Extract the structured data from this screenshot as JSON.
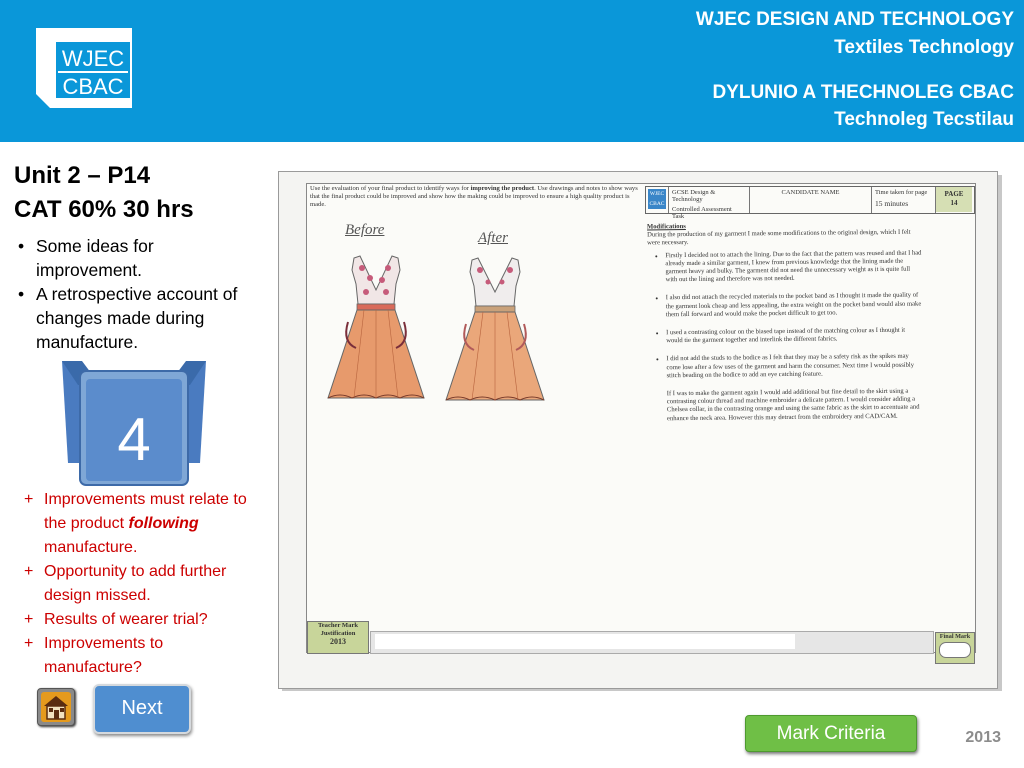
{
  "header": {
    "line1": "WJEC DESIGN AND TECHNOLOGY",
    "line2": "Textiles Technology",
    "line3": "DYLUNIO A THECHNOLEG CBAC",
    "line4": "Technoleg Tecstilau",
    "logo_top": "WJEC",
    "logo_bottom": "CBAC",
    "bg_color": "#0a97d9"
  },
  "unit": {
    "title": "Unit 2 – P14",
    "subtitle": "CAT 60% 30 hrs"
  },
  "bullets": [
    "Some ideas for improvement.",
    "A retrospective account of changes made during manufacture."
  ],
  "section_number": "4",
  "improvements": [
    {
      "before": "Improvements must relate to the product ",
      "emph": "following",
      "after": " manufacture."
    },
    {
      "before": "Opportunity to add further design missed.",
      "emph": "",
      "after": ""
    },
    {
      "before": "Results of wearer trial?",
      "emph": "",
      "after": ""
    },
    {
      "before": "Improvements to manufacture?",
      "emph": "",
      "after": ""
    }
  ],
  "buttons": {
    "home_icon": "home-icon",
    "next": "Next",
    "mark_criteria": "Mark Criteria"
  },
  "year": "2013",
  "document": {
    "instructions_pre": "Use the evaluation of your final product to identify ways for ",
    "instructions_bold": "improving the product",
    "instructions_post": ". Use drawings and notes to show ways that the final product could be improved and show how the making could be improved to ensure a high quality product is made.",
    "header_logo_top": "WJEC",
    "header_logo_bottom": "CBAC",
    "course": "GCSE Design & Technology",
    "task": "Controlled Assessment Task",
    "candidate_label": "CANDIDATE NAME",
    "time_label": "Time taken for page",
    "time_value": "15",
    "time_unit": "minutes",
    "page_label": "PAGE",
    "page_number": "14",
    "label_before": "Before",
    "label_after": "After",
    "mods_title": "Modifications",
    "mods_intro": "During the production of my garment I made some modifications to the original design, which I felt were necessary.",
    "mods_points": [
      "Firstly I decided not to attach the lining. Due to the fact that the pattern was reused and that I had already made a similar garment, I knew from previous knowledge that the lining made the garment heavy and bulky. The garment did not need the unnecessary weight as it is quite full with out the lining and therefore was not needed.",
      "I also did not attach the recycled materials to the pocket band as I thought it made the quality of the garment look cheap and less appealing, the extra weight on the pocket band would also make them fall forward and would make the pocket difficult to get too.",
      "I used a contrasting colour on the biased tape instead of the matching colour as I thought it would tie the garment together and interlink the different fabrics.",
      "I did not add the studs to the bodice as I felt that they may be a safety risk as the spikes may come lose after a few uses of the garment and harm the consumer. Next time I would possibly stitch beading on the bodice to add an eye catching feature."
    ],
    "mods_closing": "If I was to make the garment again I would add additional but fine detail to the skirt using a contrasting colour thread and machine embroider a delicate pattern. I would consider adding a Chelsea collar, in the contrasting orange and using the same fabric as the skirt to accentuate and enhance the neck area. However this may detract from the embroidery and CAD/CAM.",
    "teacher_mark_l1": "Teacher Mark",
    "teacher_mark_l2": "Justification",
    "teacher_mark_year": "2013",
    "final_mark": "Final Mark"
  }
}
